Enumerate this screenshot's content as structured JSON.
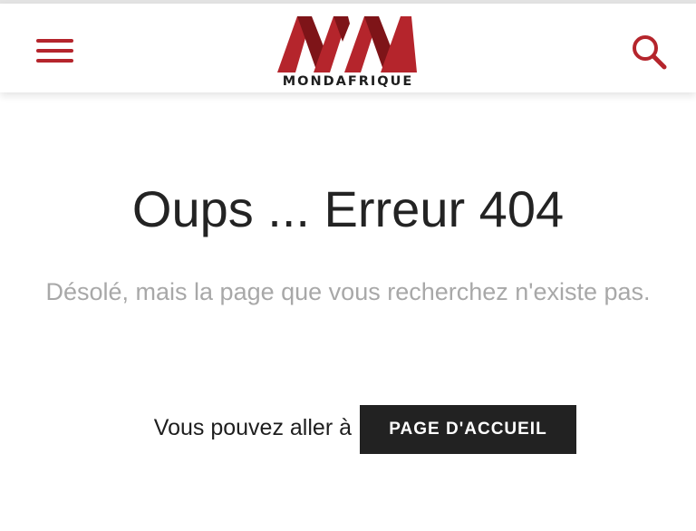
{
  "colors": {
    "brand_red": "#b5252c",
    "brand_red_dark": "#7e1418",
    "text_dark": "#232323",
    "text_muted": "#a8a8a8",
    "button_bg": "#222222",
    "button_text": "#ffffff"
  },
  "header": {
    "menu_icon": "hamburger-menu-icon",
    "search_icon": "search-icon",
    "logo": {
      "mark": "MM",
      "wordmark": "MONDAFRIQUE"
    }
  },
  "error": {
    "title": "Oups ... Erreur 404",
    "message": "Désolé, mais la page que vous recherchez n'existe pas."
  },
  "navigation": {
    "prompt": "Vous pouvez aller à",
    "home_button_label": "PAGE D'ACCUEIL"
  }
}
